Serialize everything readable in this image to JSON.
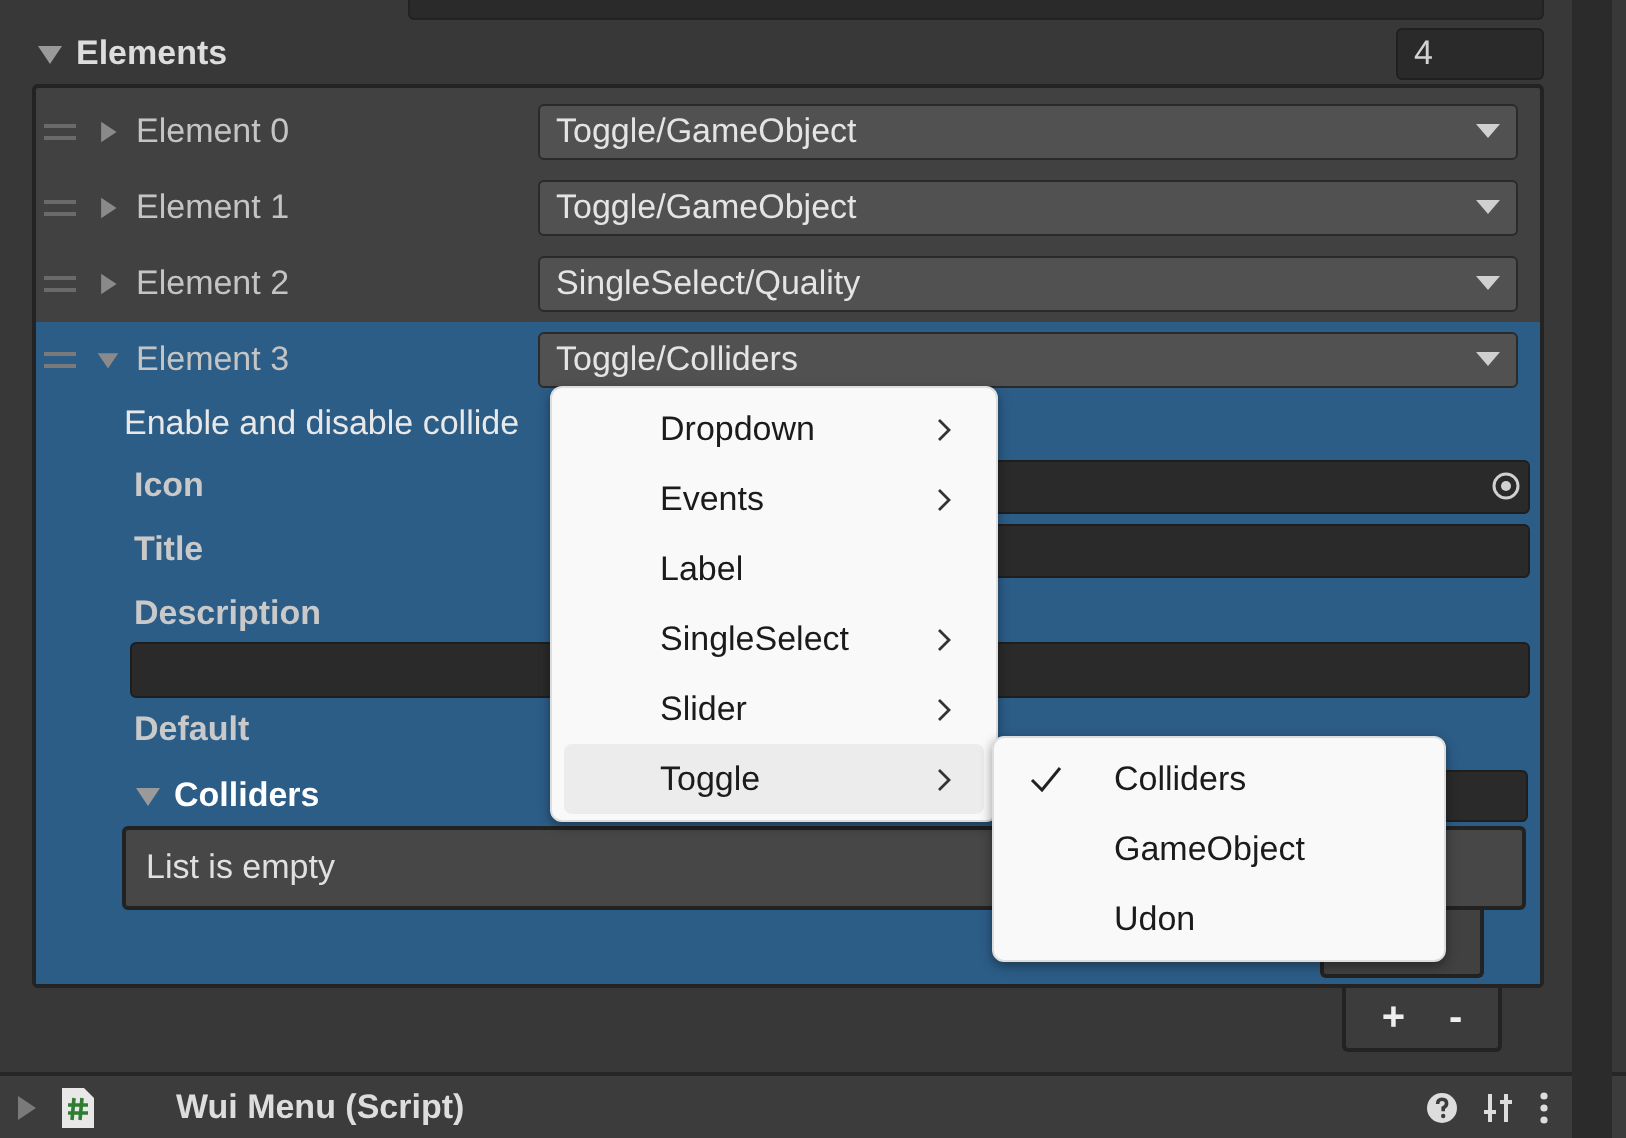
{
  "elements_header": {
    "label": "Elements",
    "expanded": true,
    "count": "4"
  },
  "elements": [
    {
      "label": "Element 0",
      "expanded": false,
      "selected": false,
      "value": "Toggle/GameObject"
    },
    {
      "label": "Element 1",
      "expanded": false,
      "selected": false,
      "value": "Toggle/GameObject"
    },
    {
      "label": "Element 2",
      "expanded": false,
      "selected": false,
      "value": "SingleSelect/Quality"
    },
    {
      "label": "Element 3",
      "expanded": true,
      "selected": true,
      "value": "Toggle/Colliders"
    }
  ],
  "element_details": {
    "description_text": "Enable and disable collide",
    "fields": [
      {
        "label": "Icon",
        "kind": "object"
      },
      {
        "label": "Title",
        "kind": "text"
      },
      {
        "label": "Description",
        "kind": "area"
      },
      {
        "label": "Default",
        "kind": "plain"
      }
    ],
    "colliders": {
      "label": "Colliders",
      "expanded": true,
      "empty_text": "List is empty"
    }
  },
  "list_footer": {
    "add": "+",
    "remove": "-"
  },
  "menu": {
    "items": [
      {
        "label": "Dropdown",
        "has_submenu": true,
        "highlighted": false
      },
      {
        "label": "Events",
        "has_submenu": true,
        "highlighted": false
      },
      {
        "label": "Label",
        "has_submenu": false,
        "highlighted": false
      },
      {
        "label": "SingleSelect",
        "has_submenu": true,
        "highlighted": false
      },
      {
        "label": "Slider",
        "has_submenu": true,
        "highlighted": false
      },
      {
        "label": "Toggle",
        "has_submenu": true,
        "highlighted": true
      }
    ],
    "submenu": [
      {
        "label": "Colliders",
        "checked": true
      },
      {
        "label": "GameObject",
        "checked": false
      },
      {
        "label": "Udon",
        "checked": false
      }
    ]
  },
  "component": {
    "title": "Wui Menu (Script)",
    "expanded": false
  }
}
